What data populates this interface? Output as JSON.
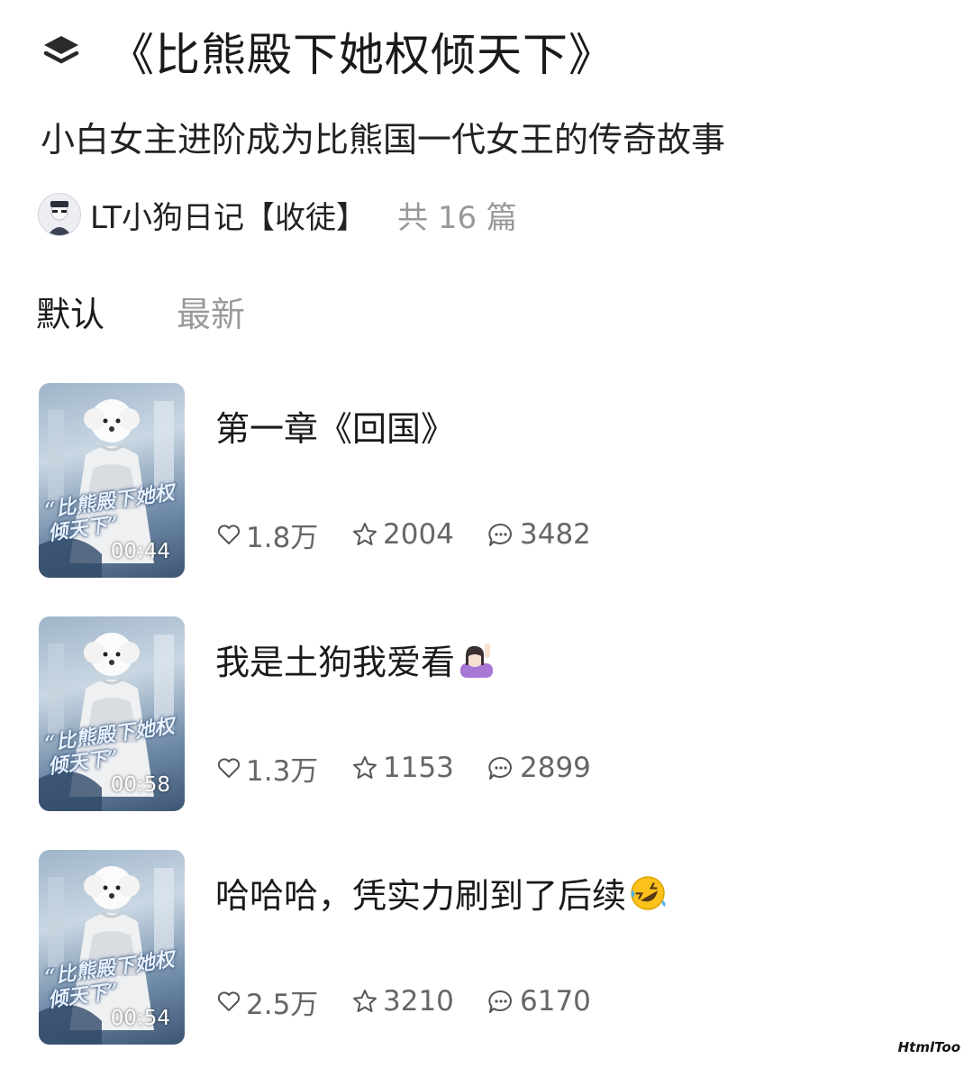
{
  "collection": {
    "title": "《比熊殿下她权倾天下》",
    "subtitle": "小白女主进阶成为比熊国一代女王的传奇故事",
    "author": "LT小狗日记【收徒】",
    "episode_count": "共 16 篇"
  },
  "tabs": [
    {
      "label": "默认",
      "active": true
    },
    {
      "label": "最新",
      "active": false
    }
  ],
  "episodes": [
    {
      "title": "第一章《回国》",
      "thumb_caption": "“比熊殿下她权倾天下”",
      "duration": "00:44",
      "likes": "1.8万",
      "favorites": "2004",
      "comments": "3482",
      "emoji": ""
    },
    {
      "title": "我是土狗我爱看",
      "thumb_caption": "“比熊殿下她权倾天下”",
      "duration": "00:58",
      "likes": "1.3万",
      "favorites": "1153",
      "comments": "2899",
      "emoji": "person-raising-hand-emoji"
    },
    {
      "title": "哈哈哈，凭实力刷到了后续",
      "thumb_caption": "“比熊殿下她权倾天下”",
      "duration": "00:54",
      "likes": "2.5万",
      "favorites": "3210",
      "comments": "6170",
      "emoji": "rolling-laughing-emoji"
    }
  ],
  "watermark": "HtmlToo",
  "colors": {
    "primary_text": "#1a1a1a",
    "secondary_text": "#999999",
    "stat_text": "#666666"
  }
}
